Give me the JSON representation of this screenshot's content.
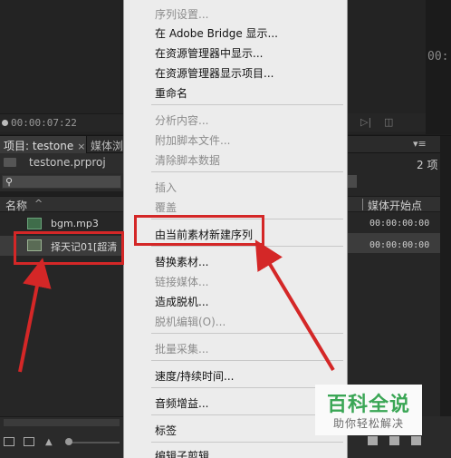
{
  "left_monitor": {
    "timecode": "00:00:07:22"
  },
  "right_monitor": {
    "timecode": "00:",
    "count_label": "2 项"
  },
  "project_panel": {
    "tab_label": "项目: testone",
    "tab_close": "×",
    "media_tab_label": "媒体浏",
    "project_file": "testone.prproj",
    "search_icon": "⚲",
    "columns": {
      "name": "名称",
      "sort_caret": "^",
      "media_start": "媒体开始点"
    },
    "items": [
      {
        "name": "bgm.mp3",
        "type": "audio",
        "media_start": "00:00:00:00"
      },
      {
        "name": "择天记01[超清",
        "type": "video",
        "media_start": "00:00:00:00"
      }
    ]
  },
  "context_menu": {
    "items": [
      {
        "label": "序列设置...",
        "enabled": false
      },
      {
        "label": "在 Adobe Bridge 显示...",
        "enabled": true
      },
      {
        "label": "在资源管理器中显示...",
        "enabled": true
      },
      {
        "label": "在资源管理器显示项目...",
        "enabled": true
      },
      {
        "label": "重命名",
        "enabled": true
      },
      {
        "label": "分析内容...",
        "enabled": false
      },
      {
        "label": "附加脚本文件...",
        "enabled": false
      },
      {
        "label": "清除脚本数据",
        "enabled": false
      },
      {
        "label": "插入",
        "enabled": false
      },
      {
        "label": "覆盖",
        "enabled": false
      },
      {
        "label": "由当前素材新建序列",
        "enabled": true
      },
      {
        "label": "替换素材...",
        "enabled": true
      },
      {
        "label": "链接媒体...",
        "enabled": false
      },
      {
        "label": "造成脱机...",
        "enabled": true
      },
      {
        "label": "脱机编辑(O)...",
        "enabled": false
      },
      {
        "label": "批量采集...",
        "enabled": false
      },
      {
        "label": "速度/持续时间...",
        "enabled": true
      },
      {
        "label": "音频增益...",
        "enabled": true
      },
      {
        "label": "标签",
        "enabled": true
      },
      {
        "label": "编辑子剪辑...",
        "enabled": true
      }
    ]
  },
  "watermark": {
    "title": "百科全说",
    "subtitle": "助你轻松解决"
  },
  "colors": {
    "highlight": "#d42727",
    "watermark_green": "#3aa655"
  }
}
